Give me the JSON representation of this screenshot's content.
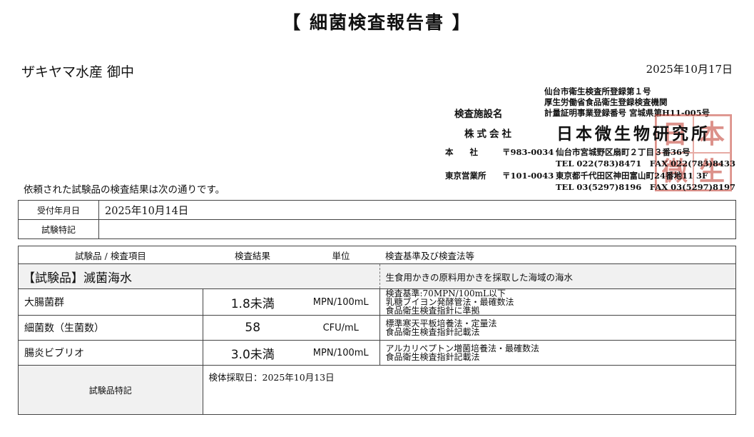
{
  "header": {
    "title": "【 細菌検査報告書 】",
    "client": "ザキヤマ水産 御中",
    "date": "2025年10月17日"
  },
  "lab": {
    "registrations": [
      "仙台市衛生検査所登録第１号",
      "厚生労働省食品衛生登録検査機関",
      "計量証明事業登録番号 宮城県第H11-005号"
    ],
    "facility_label": "検査施設名",
    "company_type": "株式会社",
    "company_name": "日本微生物研究所",
    "head_office": {
      "label": "本　　社",
      "postal": "〒983-0034",
      "address": "仙台市宮城野区扇町２丁目３番36号",
      "contact": "TEL 022(783)8471　FAX 022(783)8433"
    },
    "tokyo_office": {
      "label": "東京営業所",
      "postal": "〒101-0043",
      "address": "東京都千代田区神田富山町24番地11 3F",
      "contact": "TEL 03(5297)8196　FAX 03(5297)8197"
    },
    "seal_chars": [
      "日",
      "本",
      "微",
      "生"
    ]
  },
  "intro": "依頼された試験品の検査結果は次の通りです。",
  "info": {
    "received_label": "受付年月日",
    "received_value": "2025年10月14日",
    "notes_label": "試験特記",
    "notes_value": ""
  },
  "results": {
    "headers": {
      "item": "試験品 / 検査項目",
      "result": "検査結果",
      "unit": "単位",
      "standard": "検査基準及び検査法等"
    },
    "sample": {
      "name": "【試験品】滅菌海水",
      "description": "生食用かきの原料用かきを採取した海域の海水"
    },
    "items": [
      {
        "name": "大腸菌群",
        "result": "1.8未満",
        "unit": "MPN/100mL",
        "standard": [
          "検査基準:70MPN/100mL以下",
          "乳糖ブイヨン発酵管法・最確数法",
          "食品衛生検査指針に準拠"
        ]
      },
      {
        "name": "細菌数（生菌数）",
        "result": "58",
        "unit": "CFU/mL",
        "standard": [
          "標準寒天平板培養法・定量法",
          "食品衛生検査指針記載法"
        ]
      },
      {
        "name": "腸炎ビブリオ",
        "result": "3.0未満",
        "unit": "MPN/100mL",
        "standard": [
          "アルカリペプトン増菌培養法・最確数法",
          "食品衛生検査指針記載法"
        ]
      }
    ],
    "note_label": "試験品特記",
    "note_value": "検体採取日：2025年10月13日"
  }
}
